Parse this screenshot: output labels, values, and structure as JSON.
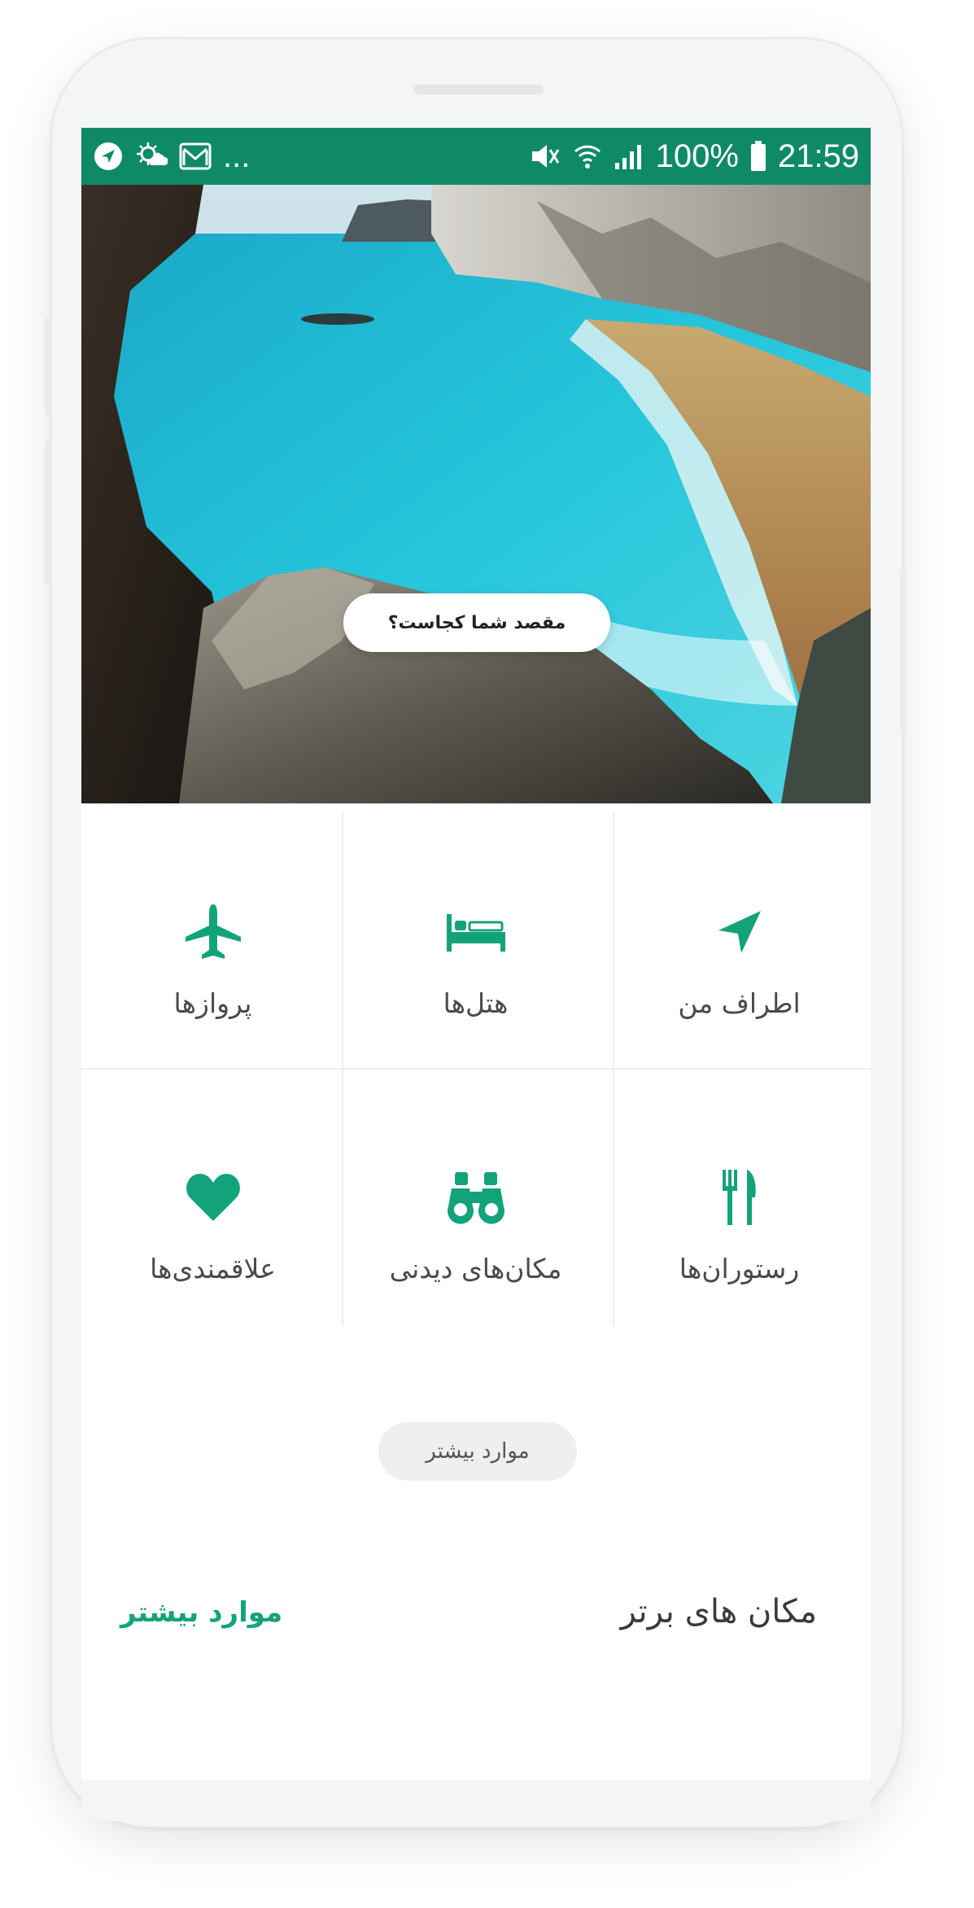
{
  "status_bar": {
    "ellipsis": "...",
    "battery": "100%",
    "time": "21:59",
    "background": "#0f8a67",
    "left_icons": [
      "location-arrow-icon",
      "weather-icon",
      "gmail-icon"
    ],
    "right_icons": [
      "mute-icon",
      "wifi-icon",
      "signal-icon",
      "battery-icon"
    ]
  },
  "hero": {
    "search_label": "مقصد شما کجاست؟"
  },
  "categories": [
    {
      "label": "اطراف من",
      "icon": "navigation-arrow-icon"
    },
    {
      "label": "هتل‌ها",
      "icon": "bed-icon"
    },
    {
      "label": "پروازها",
      "icon": "airplane-icon"
    },
    {
      "label": "رستوران‌ها",
      "icon": "fork-knife-icon"
    },
    {
      "label": "مکان‌های دیدنی",
      "icon": "binoculars-icon"
    },
    {
      "label": "علاقمندی‌ها",
      "icon": "heart-icon"
    }
  ],
  "more_button": "موارد بیشتر",
  "top_places": {
    "title": "مکان های برتر",
    "more_link": "موارد بیشتر"
  },
  "colors": {
    "accent": "#13a37a",
    "statusbar": "#0f8a67"
  }
}
